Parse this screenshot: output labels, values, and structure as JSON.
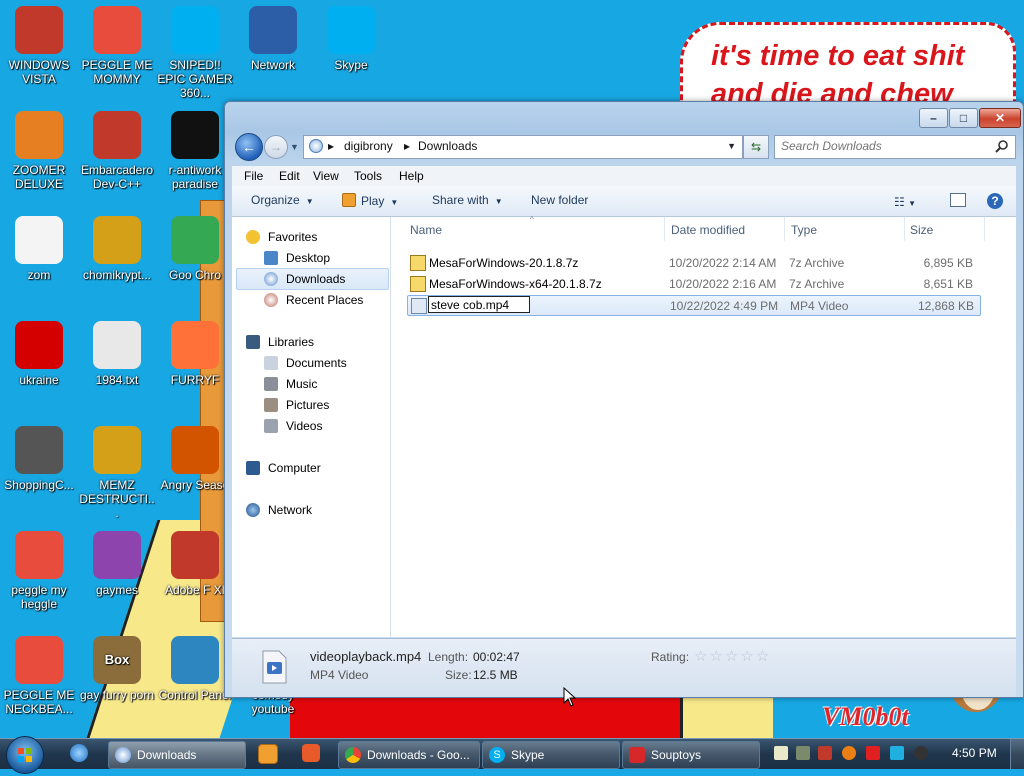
{
  "desktop": {
    "speech_text": "it's time to eat shit and die and chew",
    "watermark": "VM0b0t",
    "icons": [
      {
        "label": "WINDOWS VISTA",
        "icon": "vista-orb-icon",
        "color": "#c0392b"
      },
      {
        "label": "PEGGLE ME MOMMY",
        "icon": "peggle-icon",
        "color": "#e74c3c"
      },
      {
        "label": "SNIPED!! EPIC GAMER 360...",
        "icon": "skype-icon",
        "color": "#00aff0"
      },
      {
        "label": "Network",
        "icon": "network-icon",
        "color": "#2b5ea6"
      },
      {
        "label": "Skype",
        "icon": "skype-icon",
        "color": "#00aff0"
      },
      {
        "label": "ZOOMER DELUXE",
        "icon": "zoomer-icon",
        "color": "#e67e22"
      },
      {
        "label": "Embarcadero Dev-C++",
        "icon": "devcpp-icon",
        "color": "#c0392b"
      },
      {
        "label": "r-antiwork paradise",
        "icon": "antiwork-icon",
        "color": "#111111"
      },
      {
        "label": "zom",
        "icon": "flower-icon",
        "color": "#f4f4f4"
      },
      {
        "label": "chomikrypt...",
        "icon": "disk-icon",
        "color": "#d4a017"
      },
      {
        "label": "Goo Chro",
        "icon": "chrome-icon",
        "color": "#34a853"
      },
      {
        "label": "ukraine",
        "icon": "radiation-icon",
        "color": "#d40000"
      },
      {
        "label": "1984.txt",
        "icon": "text-file-icon",
        "color": "#e8e8e8"
      },
      {
        "label": "FURRYF",
        "icon": "firefox-icon",
        "color": "#ff7139"
      },
      {
        "label": "ShoppingC...",
        "icon": "flash-icon",
        "color": "#555555"
      },
      {
        "label": "MEMZ DESTRUCTI...",
        "icon": "disk-icon",
        "color": "#d4a017"
      },
      {
        "label": "Angry Seaso",
        "icon": "angry-birds-icon",
        "color": "#d35400"
      },
      {
        "label": "peggle my heggle",
        "icon": "peggle-icon",
        "color": "#e74c3c"
      },
      {
        "label": "gaymes",
        "icon": "games-icon",
        "color": "#8e44ad"
      },
      {
        "label": "Adobe F XI",
        "icon": "adobe-icon",
        "color": "#c0392b"
      },
      {
        "label": "PEGGLE ME NECKBEA...",
        "icon": "peggle-icon",
        "color": "#e74c3c"
      },
      {
        "label": "gay furry porn",
        "icon": "box-icon",
        "color": "#8a6d3b",
        "badge": "Box"
      },
      {
        "label": "Control Panel",
        "icon": "control-panel-icon",
        "color": "#2e86c1"
      },
      {
        "label": "youtube",
        "icon": "youtube-icon",
        "color": "#e62117",
        "prefix": "comedy"
      }
    ]
  },
  "window": {
    "address": {
      "crumbs": [
        "digibrony",
        "Downloads"
      ]
    },
    "search_placeholder": "Search Downloads",
    "menu": [
      "File",
      "Edit",
      "View",
      "Tools",
      "Help"
    ],
    "toolbar": {
      "organize": "Organize",
      "play": "Play",
      "share": "Share with",
      "new_folder": "New folder"
    },
    "nav": {
      "favorites": "Favorites",
      "desktop": "Desktop",
      "downloads": "Downloads",
      "recent": "Recent Places",
      "libraries": "Libraries",
      "documents": "Documents",
      "music": "Music",
      "pictures": "Pictures",
      "videos": "Videos",
      "computer": "Computer",
      "network": "Network"
    },
    "columns": {
      "name": "Name",
      "date": "Date modified",
      "type": "Type",
      "size": "Size"
    },
    "files": [
      {
        "name": "MesaForWindows-20.1.8.7z",
        "date": "10/20/2022 2:14 AM",
        "type": "7z Archive",
        "size": "6,895 KB"
      },
      {
        "name": "MesaForWindows-x64-20.1.8.7z",
        "date": "10/20/2022 2:16 AM",
        "type": "7z Archive",
        "size": "8,651 KB"
      },
      {
        "name": "steve cob.mp4",
        "date": "10/22/2022 4:49 PM",
        "type": "MP4 Video",
        "size": "12,868 KB"
      }
    ],
    "details": {
      "filename": "videoplayback.mp4",
      "filetype": "MP4 Video",
      "length_label": "Length:",
      "length": "00:02:47",
      "size_label": "Size:",
      "size": "12.5 MB",
      "rating_label": "Rating:",
      "rating": 0
    }
  },
  "taskbar": {
    "buttons": [
      {
        "label": "Downloads",
        "icon": "folder-icon"
      },
      {
        "label": "Downloads - Goo...",
        "icon": "chrome-icon"
      },
      {
        "label": "Skype",
        "icon": "skype-icon"
      },
      {
        "label": "Souptoys",
        "icon": "souptoys-icon"
      }
    ],
    "clock": "4:50 PM"
  }
}
